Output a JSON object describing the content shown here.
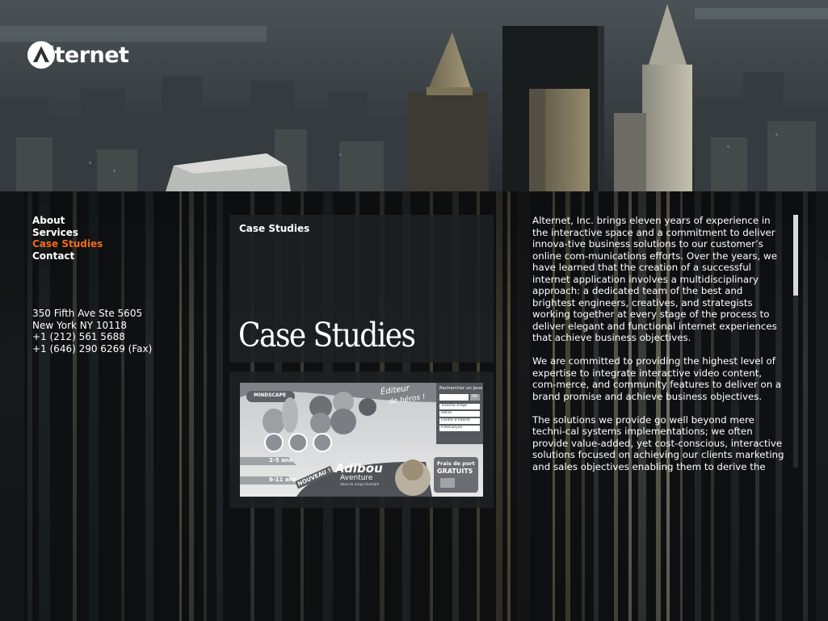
{
  "brand": {
    "name": "alternet",
    "accent_color": "#f26a1c",
    "logo_icon": "alternet-triangle-mark"
  },
  "nav": {
    "items": [
      {
        "label": "About",
        "active": false
      },
      {
        "label": "Services",
        "active": false
      },
      {
        "label": "Case Studies",
        "active": true
      },
      {
        "label": "Contact",
        "active": false
      }
    ]
  },
  "address": {
    "line1": "350 Fifth Ave Ste 5605",
    "line2": "New York NY 10118",
    "phone": "+1 (212) 561 5688",
    "fax": "+1 (646) 290 6269 (Fax)"
  },
  "case_studies": {
    "label": "Case Studies",
    "title": "Case Studies",
    "thumbnail": {
      "brand": "MINDSCAPE",
      "tagline_1": "Éditeur",
      "tagline_2": "de héros !",
      "search_label": "Rechercher un jeux",
      "search_go": "OK",
      "filters": [
        "Tranche d'Age",
        "Héros",
        "Centre d'interet",
        "Fille/Garçon"
      ],
      "ages": [
        "2-5 ans",
        "6-11 ans"
      ],
      "badge_new": "NOUVEAU !",
      "product_name": "Adibou",
      "product_sub": "Aventure",
      "product_caption": "dans le corps humain",
      "promo_1": "Frais de port",
      "promo_2": "GRATUITS"
    }
  },
  "content": {
    "paragraphs": [
      "Alternet, Inc. brings eleven years of experience in the interactive space and a commitment to deliver innova-tive business solutions to our customer’s online com-munications efforts. Over the years, we have learned that the creation of a successful internet application involves a multidisciplinary approach: a dedicated team of the best and brightest engineers, creatives, and strategists working together at every stage of the process to deliver elegant and functional internet experiences that achieve business objectives.",
      "We are committed to providing the highest level of expertise to integrate interactive video content, com-merce, and community features to deliver on a brand promise and achieve business objectives.",
      "The solutions we provide go well beyond mere techni-cal systems implementations; we often provide value-added, yet cost-conscious, interactive solutions focused on achieving our clients marketing and sales objectives enabling them to derive the highest Return On Investment from them."
    ]
  }
}
